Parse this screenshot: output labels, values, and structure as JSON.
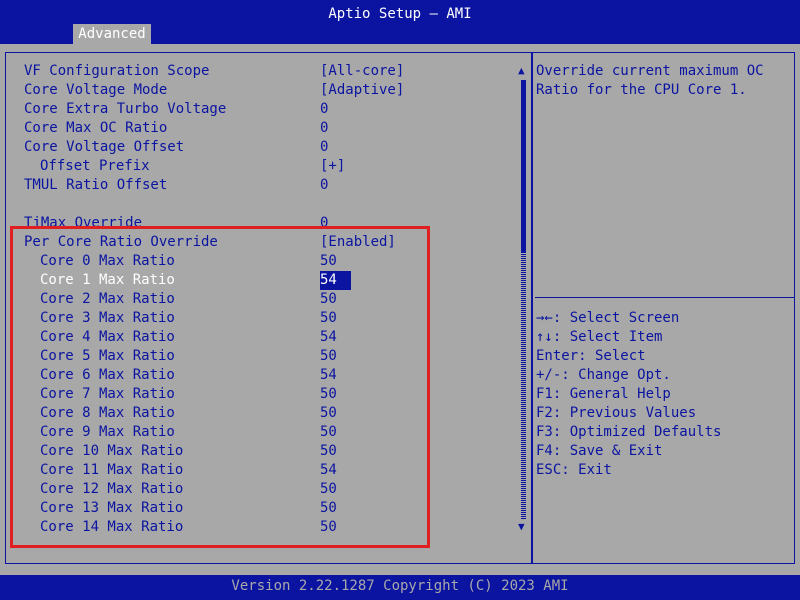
{
  "header": {
    "title": "Aptio Setup – AMI",
    "tab": "Advanced"
  },
  "settings": [
    {
      "label": "VF Configuration Scope",
      "value": "[All-core]",
      "indent": false
    },
    {
      "label": "Core Voltage Mode",
      "value": "[Adaptive]",
      "indent": false
    },
    {
      "label": "Core Extra Turbo Voltage",
      "value": "0",
      "indent": false
    },
    {
      "label": "Core Max OC Ratio",
      "value": "0",
      "indent": false
    },
    {
      "label": "Core Voltage Offset",
      "value": "0",
      "indent": false
    },
    {
      "label": "Offset Prefix",
      "value": "[+]",
      "indent": true
    },
    {
      "label": "TMUL Ratio Offset",
      "value": "0",
      "indent": false
    },
    {
      "label": "",
      "value": "",
      "indent": false
    },
    {
      "label": "TjMax Override",
      "value": "0",
      "indent": false
    },
    {
      "label": "Per Core Ratio Override",
      "value": "[Enabled]",
      "indent": false
    },
    {
      "label": "Core 0 Max Ratio",
      "value": "50",
      "indent": true
    },
    {
      "label": "Core 1 Max Ratio",
      "value": "54",
      "indent": true,
      "selected": true
    },
    {
      "label": "Core 2 Max Ratio",
      "value": "50",
      "indent": true
    },
    {
      "label": "Core 3 Max Ratio",
      "value": "50",
      "indent": true
    },
    {
      "label": "Core 4 Max Ratio",
      "value": "54",
      "indent": true
    },
    {
      "label": "Core 5 Max Ratio",
      "value": "50",
      "indent": true
    },
    {
      "label": "Core 6 Max Ratio",
      "value": "54",
      "indent": true
    },
    {
      "label": "Core 7 Max Ratio",
      "value": "50",
      "indent": true
    },
    {
      "label": "Core 8 Max Ratio",
      "value": "50",
      "indent": true
    },
    {
      "label": "Core 9 Max Ratio",
      "value": "50",
      "indent": true
    },
    {
      "label": "Core 10 Max Ratio",
      "value": "50",
      "indent": true
    },
    {
      "label": "Core 11 Max Ratio",
      "value": "54",
      "indent": true
    },
    {
      "label": "Core 12 Max Ratio",
      "value": "50",
      "indent": true
    },
    {
      "label": "Core 13 Max Ratio",
      "value": "50",
      "indent": true
    },
    {
      "label": "Core 14 Max Ratio",
      "value": "50",
      "indent": true
    }
  ],
  "help": {
    "text": "Override current maximum OC Ratio for the CPU Core 1."
  },
  "keys": [
    "→←: Select Screen",
    "↑↓: Select Item",
    "Enter: Select",
    "+/-: Change Opt.",
    "F1: General Help",
    "F2: Previous Values",
    "F3: Optimized Defaults",
    "F4: Save & Exit",
    "ESC: Exit"
  ],
  "scroll": {
    "up_glyph": "▲",
    "down_glyph": "▼"
  },
  "footer": {
    "text": "Version 2.22.1287 Copyright (C) 2023 AMI"
  },
  "colors": {
    "panel": "#a8a8a8",
    "accent": "#0a14a0",
    "highlight_box": "#e02020",
    "text_selected": "#ffffff"
  }
}
